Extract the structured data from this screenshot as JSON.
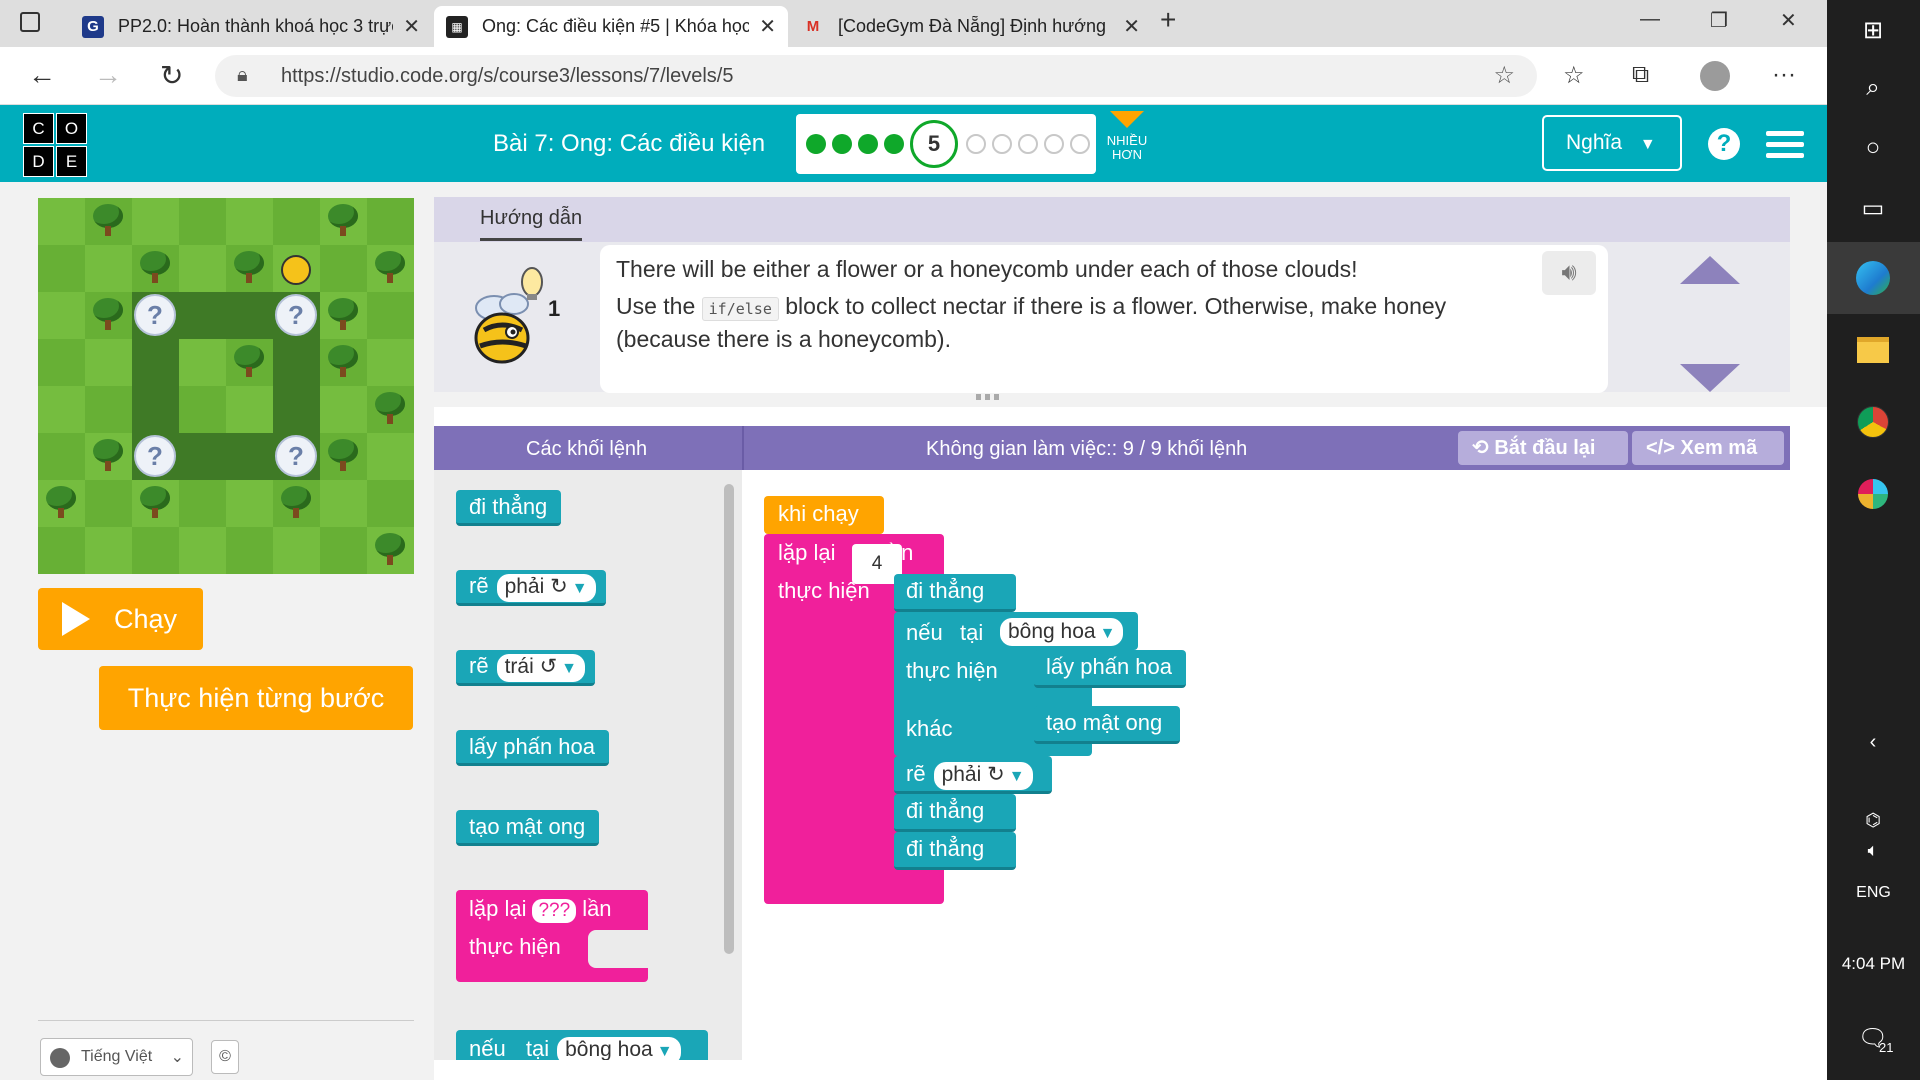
{
  "browser": {
    "tabs": [
      {
        "title": "PP2.0: Hoàn thành khoá học 3 trực",
        "favicon": "G"
      },
      {
        "title": "Ong: Các điều kiện #5 | Khóa học",
        "favicon": "grid"
      },
      {
        "title": "[CodeGym Đà Nẵng] Định hướng",
        "favicon": "M"
      }
    ],
    "url": "https://studio.code.org/s/course3/lessons/7/levels/5"
  },
  "header": {
    "logo": [
      "C",
      "O",
      "D",
      "E"
    ],
    "lesson_title": "Bài 7: Ong: Các điều kiện",
    "current_level": "5",
    "progress": {
      "completed": 4,
      "remaining": 5
    },
    "more_label": "NHIỀU HƠN",
    "user_label": "Nghĩa",
    "help_label": "?"
  },
  "left": {
    "run_label": "Chạy",
    "step_label": "Thực hiện từng bước",
    "language": "Tiếng Việt",
    "copyright_symbol": "©"
  },
  "instructions": {
    "tab_label": "Hướng dẫn",
    "line1": "There will be either a flower or a honeycomb under each of those clouds!",
    "line2_pre": "Use the",
    "line2_code": "if/else",
    "line2_post": "block to collect nectar if there is a flower. Otherwise, make honey",
    "line3": "(because there is a honeycomb).",
    "hint_count": "1"
  },
  "workspace_header": {
    "blocks_label": "Các khối lệnh",
    "workspace_label": "Không gian làm việc:: 9 / 9 khối lệnh",
    "reset_label": "Bắt đầu lại",
    "show_code_label": "Xem mã"
  },
  "toolbox": {
    "move_forward": "đi thẳng",
    "turn": "rẽ",
    "right": "phải ↻",
    "left": "trái ↺",
    "get_nectar": "lấy phấn hoa",
    "make_honey": "tạo mật ong",
    "repeat": "lặp lại",
    "repeat_unknown": "???",
    "times": "lần",
    "do": "thực hiện",
    "if": "nếu",
    "at": "tại",
    "flower": "bông hoa"
  },
  "program": {
    "when_run": "khi chạy",
    "repeat": "lặp lại",
    "count": "4",
    "times": "lần",
    "do": "thực hiện",
    "move_forward": "đi thẳng",
    "if": "nếu",
    "at": "tại",
    "flower": "bông hoa",
    "then_do": "thực hiện",
    "get_nectar": "lấy phấn hoa",
    "else": "khác",
    "make_honey": "tạo mật ong",
    "turn": "rẽ",
    "right": "phải ↻"
  },
  "maze": {
    "cloud_symbol": "?"
  },
  "taskbar": {
    "lang": "ENG",
    "time": "4:04 PM",
    "notifications": "21"
  },
  "colors": {
    "header_teal": "#00adbc",
    "action_orange": "#ffa400",
    "block_teal": "#1aa6b7",
    "block_pink": "#f0209b",
    "workspace_purple": "#7e70b8"
  }
}
